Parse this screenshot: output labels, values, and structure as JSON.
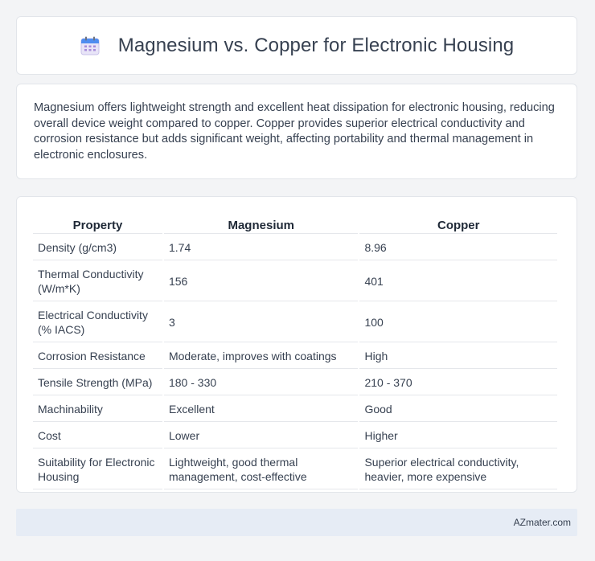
{
  "header": {
    "title": "Magnesium vs. Copper for Electronic Housing",
    "icon": "calendar-icon"
  },
  "description": "Magnesium offers lightweight strength and excellent heat dissipation for electronic housing, reducing overall device weight compared to copper. Copper provides superior electrical conductivity and corrosion resistance but adds significant weight, affecting portability and thermal management in electronic enclosures.",
  "table": {
    "headers": [
      "Property",
      "Magnesium",
      "Copper"
    ],
    "rows": [
      [
        "Density (g/cm3)",
        "1.74",
        "8.96"
      ],
      [
        "Thermal Conductivity (W/m*K)",
        "156",
        "401"
      ],
      [
        "Electrical Conductivity (% IACS)",
        "3",
        "100"
      ],
      [
        "Corrosion Resistance",
        "Moderate, improves with coatings",
        "High"
      ],
      [
        "Tensile Strength (MPa)",
        "180 - 330",
        "210 - 370"
      ],
      [
        "Machinability",
        "Excellent",
        "Good"
      ],
      [
        "Cost",
        "Lower",
        "Higher"
      ],
      [
        "Suitability for Electronic Housing",
        "Lightweight, good thermal management, cost-effective",
        "Superior electrical conductivity, heavier, more expensive"
      ]
    ]
  },
  "footer": {
    "text": "AZmater.com"
  }
}
